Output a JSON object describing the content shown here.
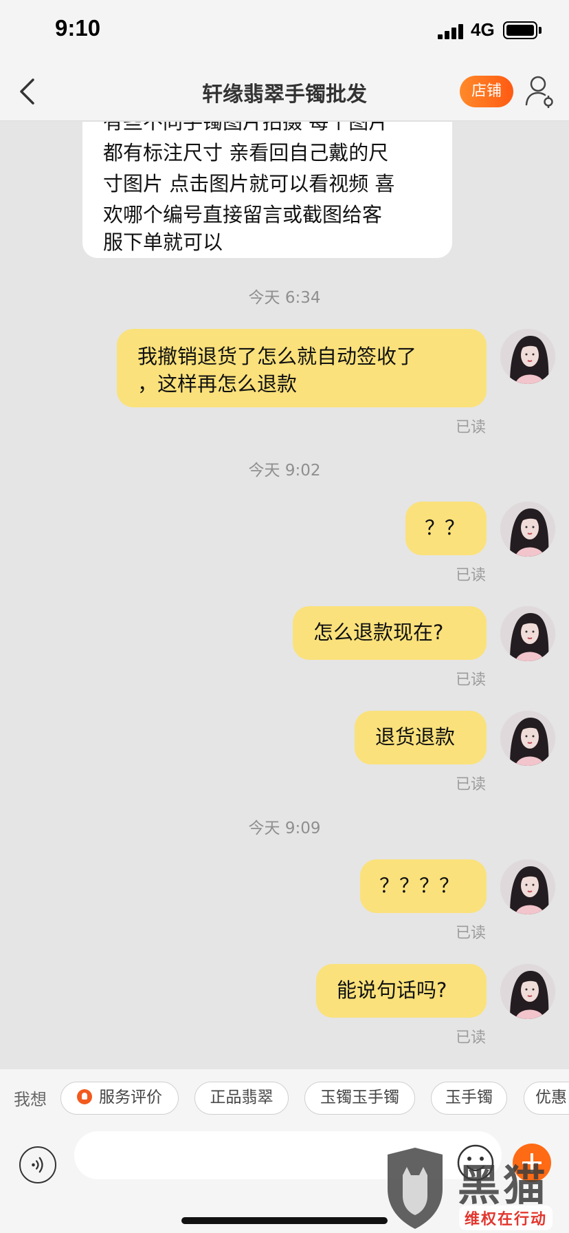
{
  "status_bar": {
    "time": "9:10",
    "network": "4G"
  },
  "nav": {
    "title": "轩缘翡翠手镯批发",
    "shop_label": "店铺"
  },
  "chat": {
    "incoming": {
      "lines": [
        "有些不同手镯图片拍摄 每个图片",
        "都有标注尺寸 亲看回自己戴的尺",
        "寸图片 点击图片就可以看视频 喜",
        "欢哪个编号直接留言或截图给客",
        "服下单就可以"
      ]
    },
    "timestamps": [
      "今天 6:34",
      "今天 9:02",
      "今天 9:09"
    ],
    "outgoing": [
      {
        "lines": [
          "我撤销退货了怎么就自动签收了",
          "，这样再怎么退款"
        ],
        "status": "已读"
      },
      {
        "lines": [
          "？？"
        ],
        "status": "已读"
      },
      {
        "lines": [
          "怎么退款现在?"
        ],
        "status": "已读"
      },
      {
        "lines": [
          "退货退款"
        ],
        "status": "已读"
      },
      {
        "lines": [
          "？？？？"
        ],
        "status": "已读"
      },
      {
        "lines": [
          "能说句话吗?"
        ],
        "status": "已读"
      }
    ]
  },
  "quick_replies": {
    "prefix": "我想",
    "chips": [
      "服务评价",
      "正品翡翠",
      "玉镯玉手镯",
      "玉手镯",
      "优惠"
    ]
  },
  "input": {
    "placeholder": "",
    "value": ""
  },
  "watermark": {
    "brand": "黑猫",
    "tagline": "维权在行动"
  },
  "colors": {
    "outgoing_bubble": "#fae17b",
    "incoming_bubble": "#ffffff",
    "accent": "#ff6a14",
    "chat_background": "#e5e5e5"
  },
  "icons": {
    "back": "chevron-left-icon",
    "profile": "user-settings-icon",
    "voice": "voice-icon",
    "emoji": "smile-icon",
    "plus": "plus-icon"
  }
}
